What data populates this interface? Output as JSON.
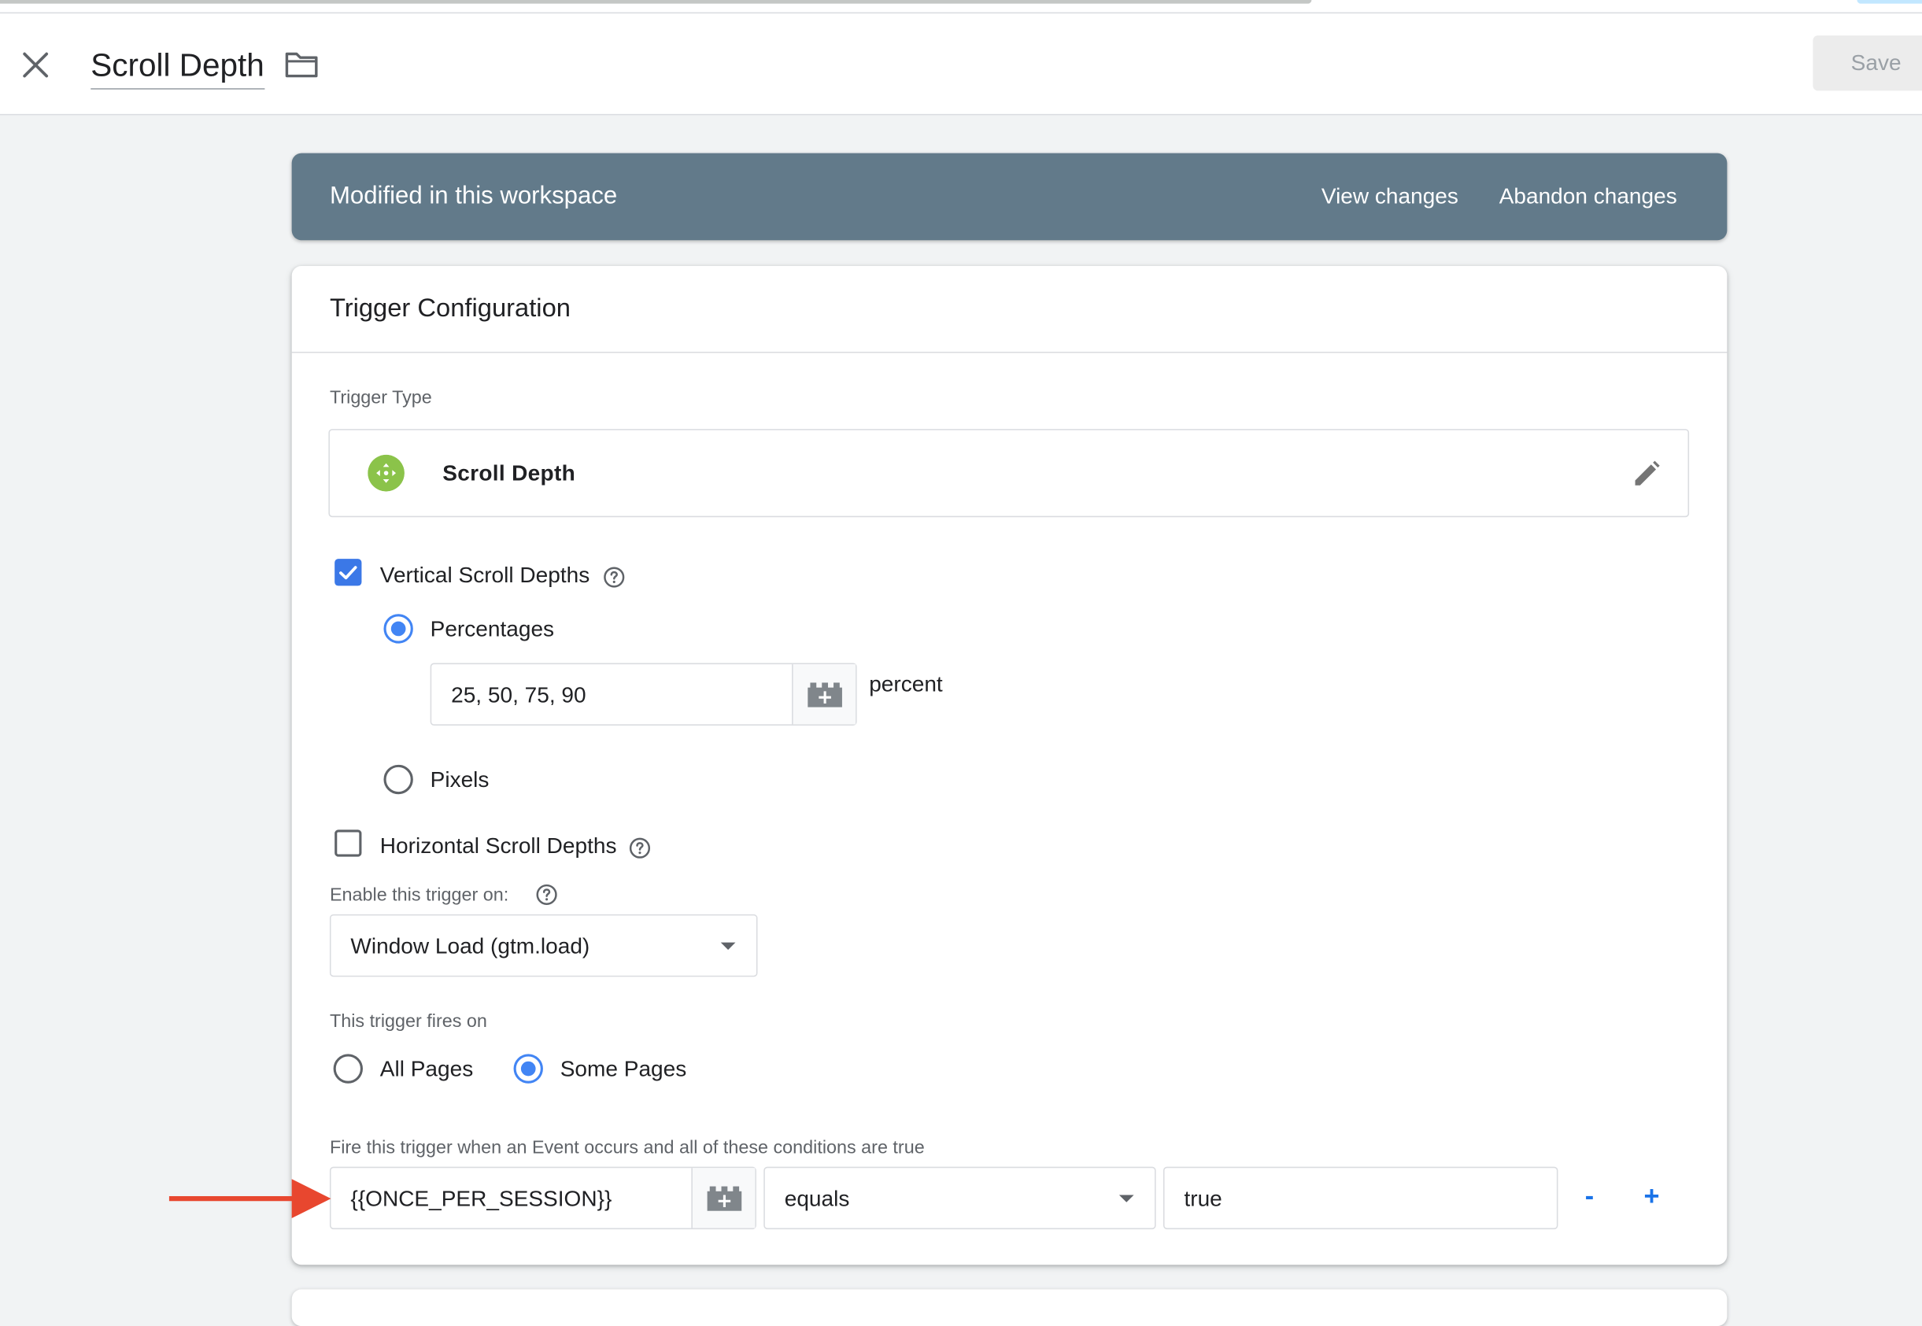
{
  "header": {
    "title": "Scroll Depth",
    "save_label": "Save"
  },
  "banner": {
    "text": "Modified in this workspace",
    "view_changes": "View changes",
    "abandon_changes": "Abandon changes"
  },
  "card": {
    "title": "Trigger Configuration",
    "trigger_type_label": "Trigger Type",
    "trigger_type_value": "Scroll Depth",
    "vertical": {
      "label": "Vertical Scroll Depths",
      "checked": true,
      "percentages_label": "Percentages",
      "percentages_value": "25, 50, 75, 90",
      "percent_suffix": "percent",
      "pixels_label": "Pixels"
    },
    "horizontal": {
      "label": "Horizontal Scroll Depths",
      "checked": false
    },
    "enable_on": {
      "label": "Enable this trigger on:",
      "selected": "Window Load (gtm.load)"
    },
    "fires_on": {
      "label": "This trigger fires on",
      "all_pages": "All Pages",
      "some_pages": "Some Pages",
      "selected": "Some Pages"
    },
    "condition": {
      "label": "Fire this trigger when an Event occurs and all of these conditions are true",
      "variable": "{{ONCE_PER_SESSION}}",
      "operator": "equals",
      "value": "true",
      "remove_label": "-",
      "add_label": "+"
    }
  },
  "colors": {
    "banner": "#627a8a",
    "accent_blue": "#4285f4",
    "checkbox_blue": "#3b78e7",
    "arrow_red": "#e8472f",
    "trigger_icon_green": "#8bc34a"
  }
}
